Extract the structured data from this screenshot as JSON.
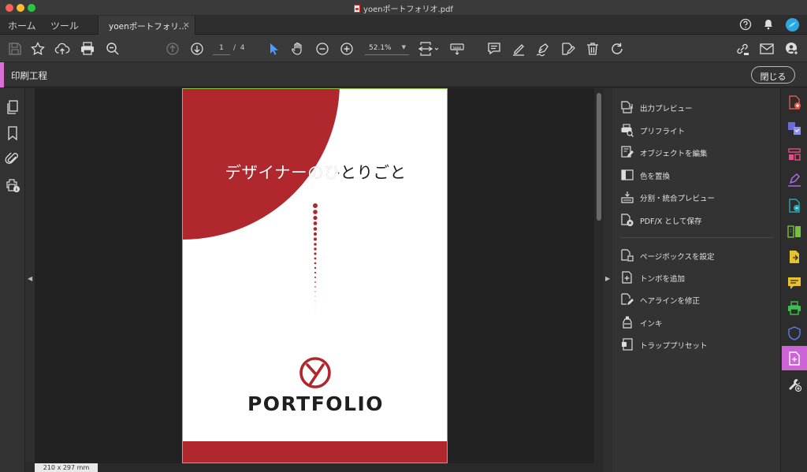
{
  "window": {
    "title": "yoenポートフォリオ.pdf"
  },
  "nav": {
    "home": "ホーム",
    "tools": "ツール"
  },
  "tab": {
    "label": "yoenポートフォリ…",
    "close": "×"
  },
  "toolbar": {
    "current_page": "1",
    "page_sep": "/",
    "total_pages": "4",
    "zoom": "52.1%"
  },
  "tool_header": {
    "title": "印刷工程",
    "close_label": "閉じる"
  },
  "document": {
    "headline": "デザイナーのひとりごと",
    "brand": "PORTFOLIO",
    "page_size": "210 x 297 mm",
    "accent_color": "#b0282d"
  },
  "panel": {
    "items": [
      {
        "label": "出力プレビュー",
        "icon": "output-preview-icon"
      },
      {
        "label": "プリフライト",
        "icon": "preflight-icon"
      },
      {
        "label": "オブジェクトを編集",
        "icon": "edit-object-icon"
      },
      {
        "label": "色を置換",
        "icon": "replace-color-icon"
      },
      {
        "label": "分割・統合プレビュー",
        "icon": "flattener-preview-icon"
      },
      {
        "label": "PDF/X として保存",
        "icon": "save-pdfx-icon"
      },
      {
        "label": "ページボックスを設定",
        "icon": "page-box-icon"
      },
      {
        "label": "トンボを追加",
        "icon": "printer-marks-icon"
      },
      {
        "label": "ヘアラインを修正",
        "icon": "hairline-icon"
      },
      {
        "label": "インキ",
        "icon": "ink-icon"
      },
      {
        "label": "トラッププリセット",
        "icon": "trap-preset-icon"
      }
    ]
  },
  "colors": {
    "highlight": "#d670d6",
    "active_rail": "#cc64d6",
    "selection_blue": "#4a9eff"
  }
}
